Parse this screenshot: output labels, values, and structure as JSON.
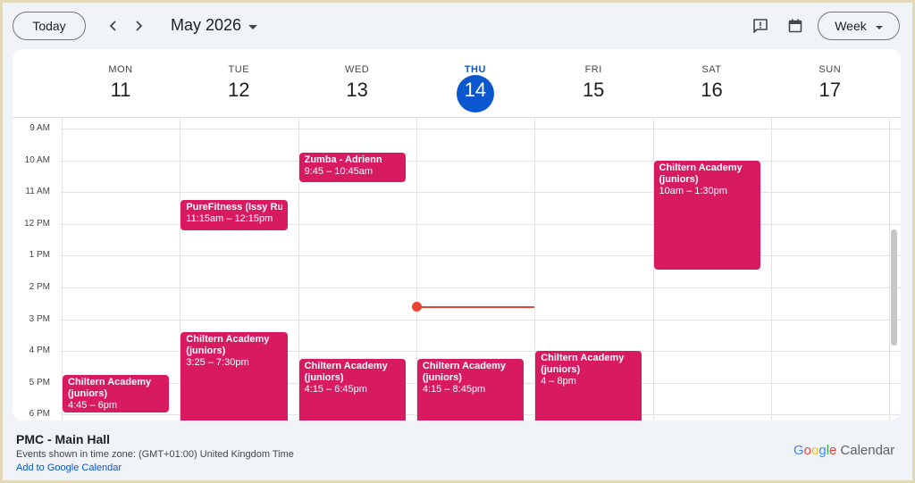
{
  "toolbar": {
    "today_label": "Today",
    "prev_icon": "chevron-left-icon",
    "next_icon": "chevron-right-icon",
    "month_label": "May 2026",
    "feedback_icon": "feedback-icon",
    "calendar_icon": "calendar-icon",
    "view_label": "Week"
  },
  "days": [
    {
      "name": "MON",
      "num": "11",
      "today": false
    },
    {
      "name": "TUE",
      "num": "12",
      "today": false
    },
    {
      "name": "WED",
      "num": "13",
      "today": false
    },
    {
      "name": "THU",
      "num": "14",
      "today": true
    },
    {
      "name": "FRI",
      "num": "15",
      "today": false
    },
    {
      "name": "SAT",
      "num": "16",
      "today": false
    },
    {
      "name": "SUN",
      "num": "17",
      "today": false
    }
  ],
  "hours": [
    "9 AM",
    "10 AM",
    "11 AM",
    "12 PM",
    "1 PM",
    "2 PM",
    "3 PM",
    "4 PM",
    "5 PM",
    "6 PM"
  ],
  "events": [
    {
      "day": 0,
      "title": "Chiltern Academy (juniors)",
      "time": "4:45 – 6pm",
      "start": 16.75,
      "end": 18.0
    },
    {
      "day": 1,
      "title": "PureFitness (Issy Russell)",
      "time": "11:15am – 12:15pm",
      "start": 11.25,
      "end": 12.25
    },
    {
      "day": 1,
      "title": "Chiltern Academy (juniors)",
      "time": "3:25 – 7:30pm",
      "start": 15.4167,
      "end": 19.5
    },
    {
      "day": 2,
      "title": "Zumba - Adrienn",
      "time": "9:45 – 10:45am",
      "start": 9.75,
      "end": 10.75
    },
    {
      "day": 2,
      "title": "Chiltern Academy (juniors)",
      "time": "4:15 – 6:45pm",
      "start": 16.25,
      "end": 18.75
    },
    {
      "day": 3,
      "title": "Chiltern Academy (juniors)",
      "time": "4:15 – 8:45pm",
      "start": 16.25,
      "end": 20.75
    },
    {
      "day": 4,
      "title": "Chiltern Academy (juniors)",
      "time": "4 – 8pm",
      "start": 16.0,
      "end": 20.0
    },
    {
      "day": 5,
      "title": "Chiltern Academy (juniors)",
      "time": "10am – 1:30pm",
      "start": 10.0,
      "end": 13.5
    }
  ],
  "now": {
    "day": 3,
    "hour": 14.58
  },
  "colors": {
    "event": "#d81b60",
    "today": "#0b57d0",
    "now": "#ea4335"
  },
  "footer": {
    "calendar_name": "PMC - Main Hall",
    "timezone": "Events shown in time zone: (GMT+01:00) United Kingdom Time",
    "add_link": "Add to Google Calendar",
    "brand_google": [
      "G",
      "o",
      "o",
      "g",
      "l",
      "e"
    ],
    "brand_calendar": "Calendar"
  }
}
